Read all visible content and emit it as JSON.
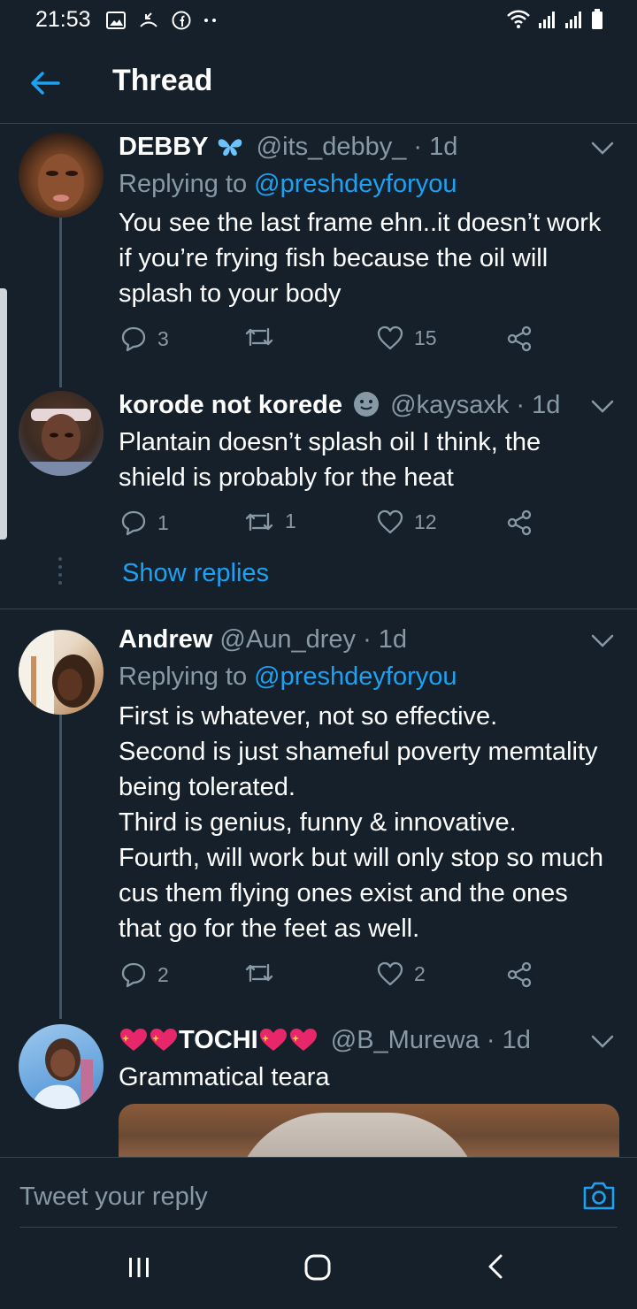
{
  "status_bar": {
    "time": "21:53",
    "left_icons": [
      "image-icon",
      "missed-call-icon",
      "facebook-icon",
      "more-dots-icon"
    ],
    "right_icons": [
      "wifi-icon",
      "signal-icon",
      "signal-icon",
      "battery-icon"
    ]
  },
  "header": {
    "title": "Thread",
    "back_icon": "back-arrow-icon"
  },
  "colors": {
    "background": "#15202b",
    "accent": "#1da1f2",
    "secondary_text": "#8899a6",
    "divider": "#38444d"
  },
  "tweets": [
    {
      "name": "DEBBY",
      "name_emoji": "butterfly-icon",
      "handle": "@its_debby_",
      "time": "· 1d",
      "replying_prefix": "Replying to",
      "replying_to": "@preshdeyforyou",
      "text": "You see the last frame ehn..it doesn’t work if you’re frying fish because the oil will splash to your body",
      "replies": "3",
      "retweets": "",
      "likes": "15"
    },
    {
      "name": "korode not korede",
      "name_emoji": "slightly-smiling-face-icon",
      "handle": "@kaysaxk",
      "time": "· 1d",
      "text": "Plantain doesn’t splash oil I think, the shield is probably for the heat",
      "replies": "1",
      "retweets": "1",
      "likes": "12"
    },
    {
      "name": "Andrew",
      "handle": "@Aun_drey",
      "time": "· 1d",
      "replying_prefix": "Replying to",
      "replying_to": "@preshdeyforyou",
      "text": "First is whatever, not so effective.\nSecond is just shameful poverty memtality being tolerated.\nThird is genius, funny & innovative.\nFourth, will work but will only stop so much cus them flying ones exist and the ones that go for the feet as well.",
      "replies": "2",
      "retweets": "",
      "likes": "2"
    },
    {
      "name": "TOCHI",
      "name_emoji": "sparkling-heart-icon",
      "handle": "@B_Murewa",
      "time": "· 1d",
      "text": "Grammatical teara"
    }
  ],
  "show_replies": "Show replies",
  "composer": {
    "placeholder": "Tweet your reply"
  },
  "nav": [
    "recent-apps-icon",
    "home-icon",
    "back-icon"
  ]
}
